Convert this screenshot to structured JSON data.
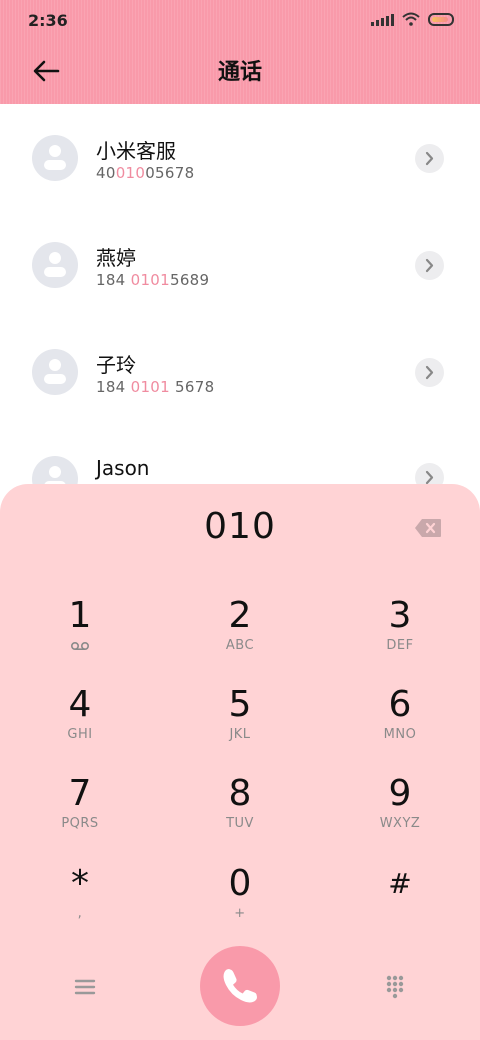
{
  "status_bar": {
    "time": "2:36"
  },
  "header": {
    "title": "通话"
  },
  "contacts": [
    {
      "name": "小米客服",
      "number_parts": [
        "40",
        "010",
        "05678"
      ]
    },
    {
      "name": "燕婷",
      "number_parts": [
        "184 ",
        "0101",
        "5689"
      ]
    },
    {
      "name": "子玲",
      "number_parts": [
        "184 ",
        "0101",
        " 5678"
      ]
    },
    {
      "name": "Jason",
      "number_parts": [
        "",
        "",
        ""
      ]
    }
  ],
  "dialer": {
    "input_value": "010",
    "keys": [
      {
        "digit": "1",
        "letters": "",
        "icon": "voicemail-icon"
      },
      {
        "digit": "2",
        "letters": "ABC"
      },
      {
        "digit": "3",
        "letters": "DEF"
      },
      {
        "digit": "4",
        "letters": "GHI"
      },
      {
        "digit": "5",
        "letters": "JKL"
      },
      {
        "digit": "6",
        "letters": "MNO"
      },
      {
        "digit": "7",
        "letters": "PQRS"
      },
      {
        "digit": "8",
        "letters": "TUV"
      },
      {
        "digit": "9",
        "letters": "WXYZ"
      },
      {
        "digit": "*",
        "letters": ","
      },
      {
        "digit": "0",
        "letters": "+"
      },
      {
        "digit": "#",
        "letters": ""
      }
    ]
  },
  "colors": {
    "accent": "#f99aaa",
    "dialer_bg": "#ffd3d5",
    "highlight": "#f08ca0"
  }
}
